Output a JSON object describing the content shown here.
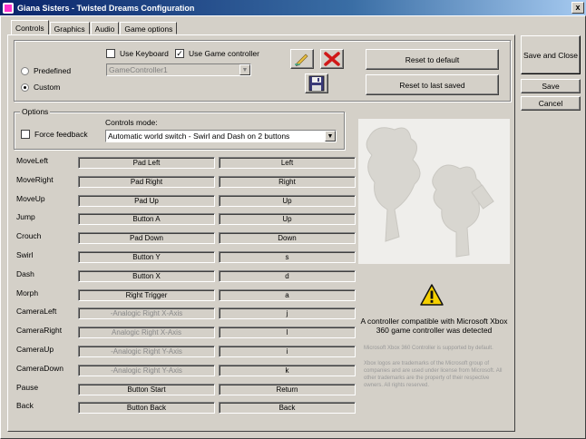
{
  "window": {
    "title": "Giana Sisters - Twisted Dreams Configuration",
    "close": "x"
  },
  "tabs": [
    "Controls",
    "Graphics",
    "Audio",
    "Game options"
  ],
  "controller": {
    "predefined_label": "Predefined",
    "custom_label": "Custom",
    "use_keyboard_label": "Use Keyboard",
    "use_keyboard_checked": false,
    "use_controller_label": "Use Game controller",
    "use_controller_checked": true,
    "controller_select": "GameController1",
    "reset_default": "Reset to default",
    "reset_saved": "Reset to last saved",
    "selected_mode": "Custom"
  },
  "options": {
    "group_label": "Options",
    "force_feedback_label": "Force feedback",
    "force_feedback_checked": false,
    "mode_label": "Controls mode:",
    "mode_value": "Automatic world switch - Swirl and Dash on 2 buttons"
  },
  "bindings": [
    {
      "action": "MoveLeft",
      "pad": "Pad Left",
      "key": "Left",
      "pad_disabled": false
    },
    {
      "action": "MoveRight",
      "pad": "Pad Right",
      "key": "Right",
      "pad_disabled": false
    },
    {
      "action": "MoveUp",
      "pad": "Pad Up",
      "key": "Up",
      "pad_disabled": false
    },
    {
      "action": "Jump",
      "pad": "Button A",
      "key": "Up",
      "pad_disabled": false
    },
    {
      "action": "Crouch",
      "pad": "Pad Down",
      "key": "Down",
      "pad_disabled": false
    },
    {
      "action": "Swirl",
      "pad": "Button Y",
      "key": "s",
      "pad_disabled": false
    },
    {
      "action": "Dash",
      "pad": "Button X",
      "key": "d",
      "pad_disabled": false
    },
    {
      "action": "Morph",
      "pad": "Right Trigger",
      "key": "a",
      "pad_disabled": false
    },
    {
      "action": "CameraLeft",
      "pad": "-Analogic Right X-Axis",
      "key": "j",
      "pad_disabled": true
    },
    {
      "action": "CameraRight",
      "pad": "Analogic Right X-Axis",
      "key": "l",
      "pad_disabled": true
    },
    {
      "action": "CameraUp",
      "pad": "-Analogic Right Y-Axis",
      "key": "i",
      "pad_disabled": true
    },
    {
      "action": "CameraDown",
      "pad": "-Analogic Right Y-Axis",
      "key": "k",
      "pad_disabled": true
    },
    {
      "action": "Pause",
      "pad": "Button Start",
      "key": "Return",
      "pad_disabled": false
    },
    {
      "action": "Back",
      "pad": "Button Back",
      "key": "Back",
      "pad_disabled": false
    }
  ],
  "side": {
    "detected": "A controller compatible with Microsoft Xbox 360 game controller was detected",
    "supported": "Microsoft Xbox 360 Controller is supported by default.",
    "trademark": "Xbox logos are trademarks of the Microsoft group of companies and are used under license from Microsoft. All other trademarks are the property of their respective owners. All rights reserved."
  },
  "buttons": {
    "save_close": "Save and Close",
    "save": "Save",
    "cancel": "Cancel"
  },
  "icons": {
    "edit": "pencil-icon",
    "delete": "red-x-icon",
    "save": "floppy-disk-icon",
    "warning": "warning-icon"
  }
}
